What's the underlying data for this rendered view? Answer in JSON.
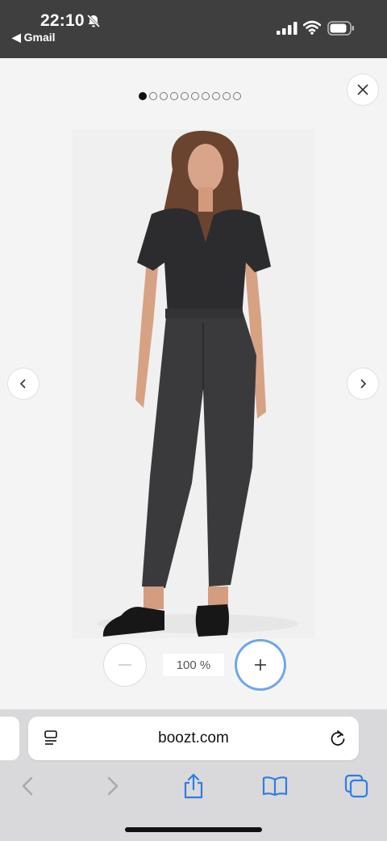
{
  "status_bar": {
    "time": "22:10",
    "back_app": "◀ Gmail"
  },
  "viewer": {
    "image_count": 10,
    "active_index": 0,
    "zoom_level": "100 %"
  },
  "browser": {
    "url": "boozt.com"
  },
  "colors": {
    "status_bg": "#3f3f3f",
    "viewer_bg": "#f4f4f4",
    "accent": "#2f7de1",
    "focus_ring": "#6fa7e6"
  },
  "icons": [
    "bell-slash-icon",
    "signal-icon",
    "wifi-icon",
    "battery-icon",
    "close-icon",
    "chevron-left-icon",
    "chevron-right-icon",
    "minus-icon",
    "plus-icon",
    "page-menu-icon",
    "reload-icon",
    "back-arrow-icon",
    "forward-arrow-icon",
    "share-icon",
    "bookmarks-icon",
    "tabs-icon"
  ]
}
